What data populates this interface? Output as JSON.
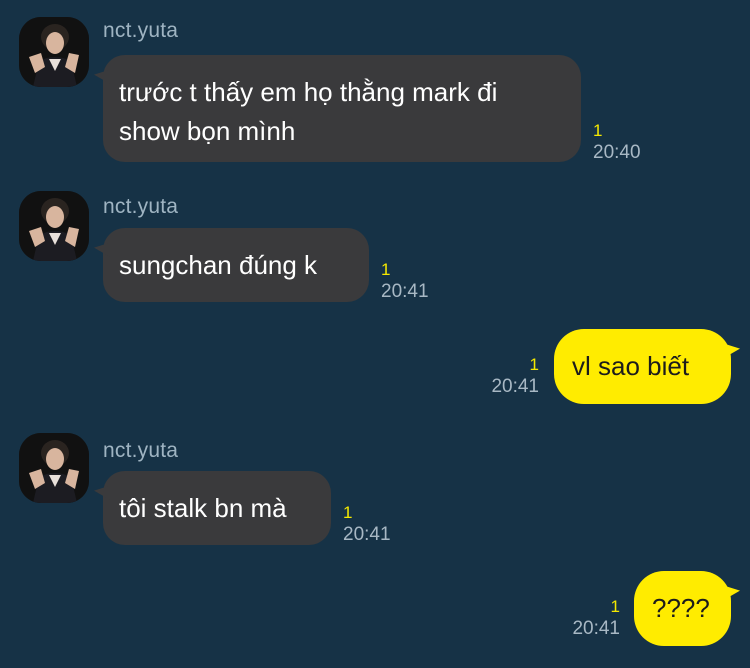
{
  "messages": [
    {
      "direction": "in",
      "sender": "nct.yuta",
      "text_lines": [
        "trước t thấy em họ thằng mark đi",
        "show bọn mình"
      ],
      "read_count": "1",
      "time": "20:40"
    },
    {
      "direction": "in",
      "sender": "nct.yuta",
      "text_lines": [
        "sungchan đúng k"
      ],
      "read_count": "1",
      "time": "20:41"
    },
    {
      "direction": "out",
      "text_lines": [
        "vl sao biết"
      ],
      "read_count": "1",
      "time": "20:41"
    },
    {
      "direction": "in",
      "sender": "nct.yuta",
      "text_lines": [
        "tôi stalk bn mà"
      ],
      "read_count": "1",
      "time": "20:41"
    },
    {
      "direction": "out",
      "text_lines": [
        "????"
      ],
      "read_count": "1",
      "time": "20:41"
    }
  ],
  "colors": {
    "background": "#163246",
    "incoming_bubble": "#3a3a3c",
    "outgoing_bubble": "#ffec00",
    "read_count": "#f4e800"
  },
  "icons": {
    "avatar": "profile-photo"
  }
}
